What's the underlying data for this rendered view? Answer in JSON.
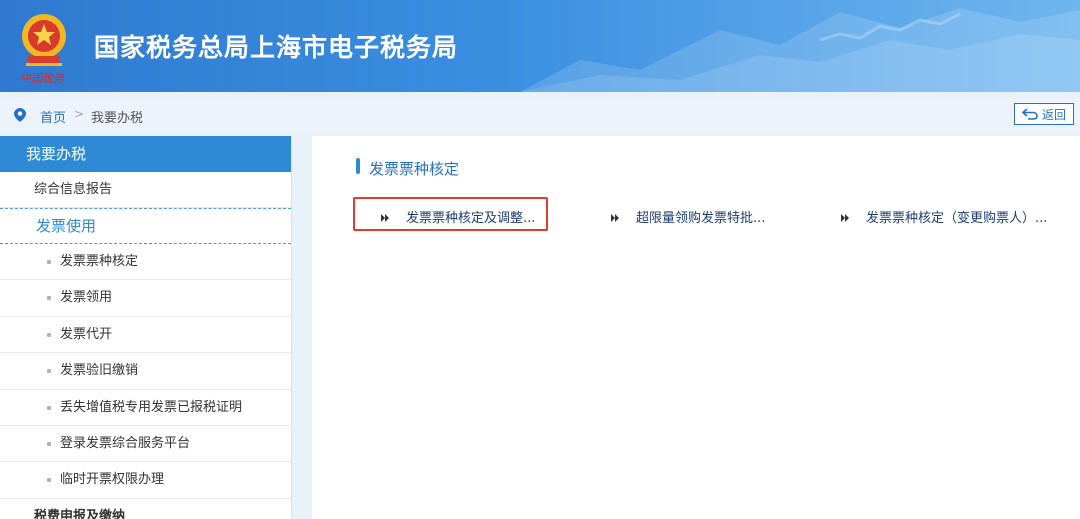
{
  "header": {
    "title": "国家税务总局上海市电子税务局",
    "emblem_text": "中国税务",
    "emblem_icon": "national-tax-emblem-icon",
    "bg_color": "#2f7ad0"
  },
  "breadcrumb": {
    "home": "首页",
    "separator": ">",
    "current": "我要办税",
    "icon": "location-pin-icon"
  },
  "back_button": {
    "label": "返回",
    "icon": "return-arrow-icon"
  },
  "sidebar": {
    "title": "我要办税",
    "top_item": "综合信息报告",
    "group": "发票使用",
    "sub_items": [
      "发票票种核定",
      "发票领用",
      "发票代开",
      "发票验旧缴销",
      "丢失增值税专用发票已报税证明",
      "登录发票综合服务平台",
      "临时开票权限办理"
    ],
    "bottom_item": "税费申报及缴纳"
  },
  "main": {
    "section_title": "发票票种核定",
    "links": [
      {
        "label": "发票票种核定及调整...",
        "highlighted": true
      },
      {
        "label": "超限量领购发票特批..."
      },
      {
        "label": "发票票种核定（变更购票人）..."
      }
    ],
    "highlight_color": "#e53935",
    "accent_color": "#2f8ad6"
  }
}
